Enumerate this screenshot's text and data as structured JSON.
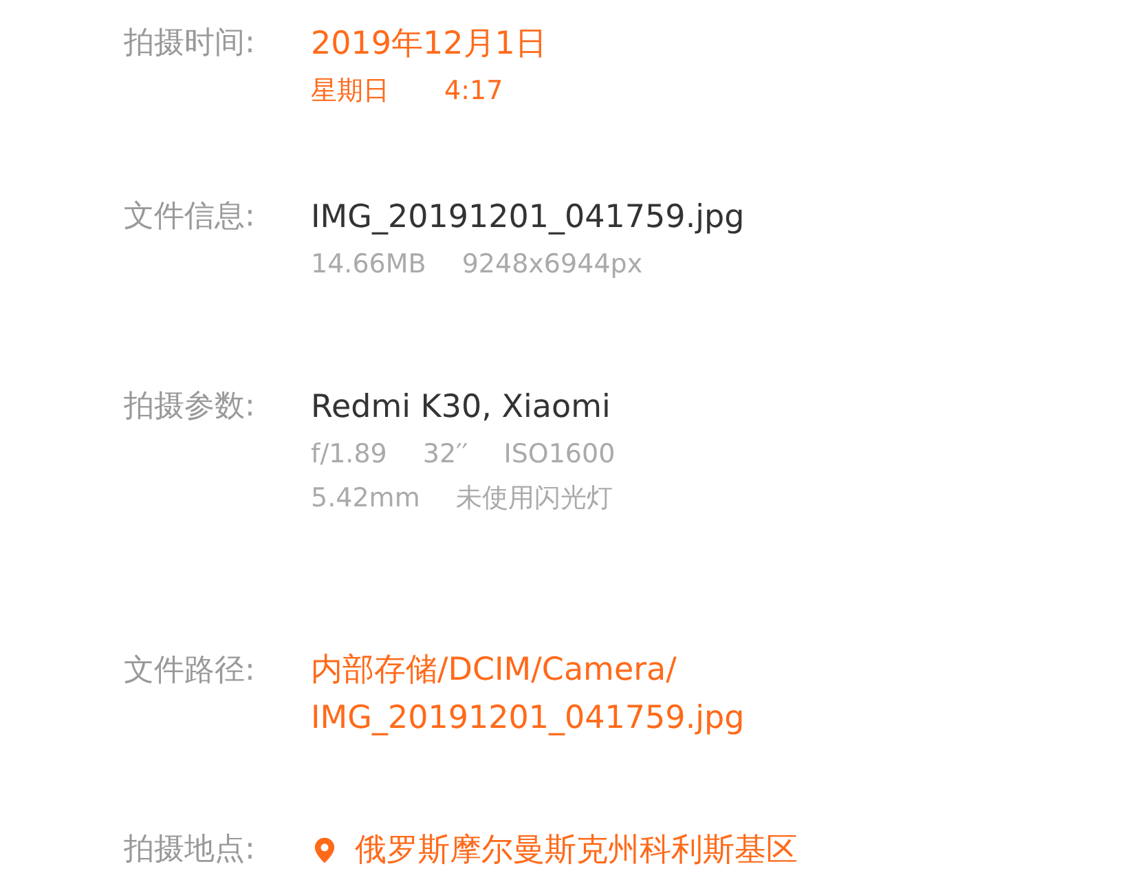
{
  "rows": [
    {
      "label": "拍摄时间:",
      "kind": "time",
      "main": [
        "2019年12月1日"
      ],
      "sub": [
        [
          "星期日",
          "4:17"
        ]
      ]
    },
    {
      "label": "文件信息:",
      "kind": "info",
      "main": [
        "IMG_20191201_041759.jpg"
      ],
      "sub": [
        [
          "14.66MB",
          "9248x6944px"
        ]
      ]
    },
    {
      "label": "拍摄参数:",
      "kind": "info",
      "main": [
        "Redmi K30, Xiaomi"
      ],
      "sub": [
        [
          "f/1.89",
          "32′′",
          "ISO1600"
        ],
        [
          "5.42mm",
          "未使用闪光灯"
        ]
      ]
    },
    {
      "label": "文件路径:",
      "kind": "path",
      "main": [
        "内部存储/DCIM/Camera/",
        "IMG_20191201_041759.jpg"
      ]
    },
    {
      "label": "拍摄地点:",
      "kind": "location",
      "main": [
        "俄罗斯摩尔曼斯克州科利斯基区"
      ]
    }
  ]
}
